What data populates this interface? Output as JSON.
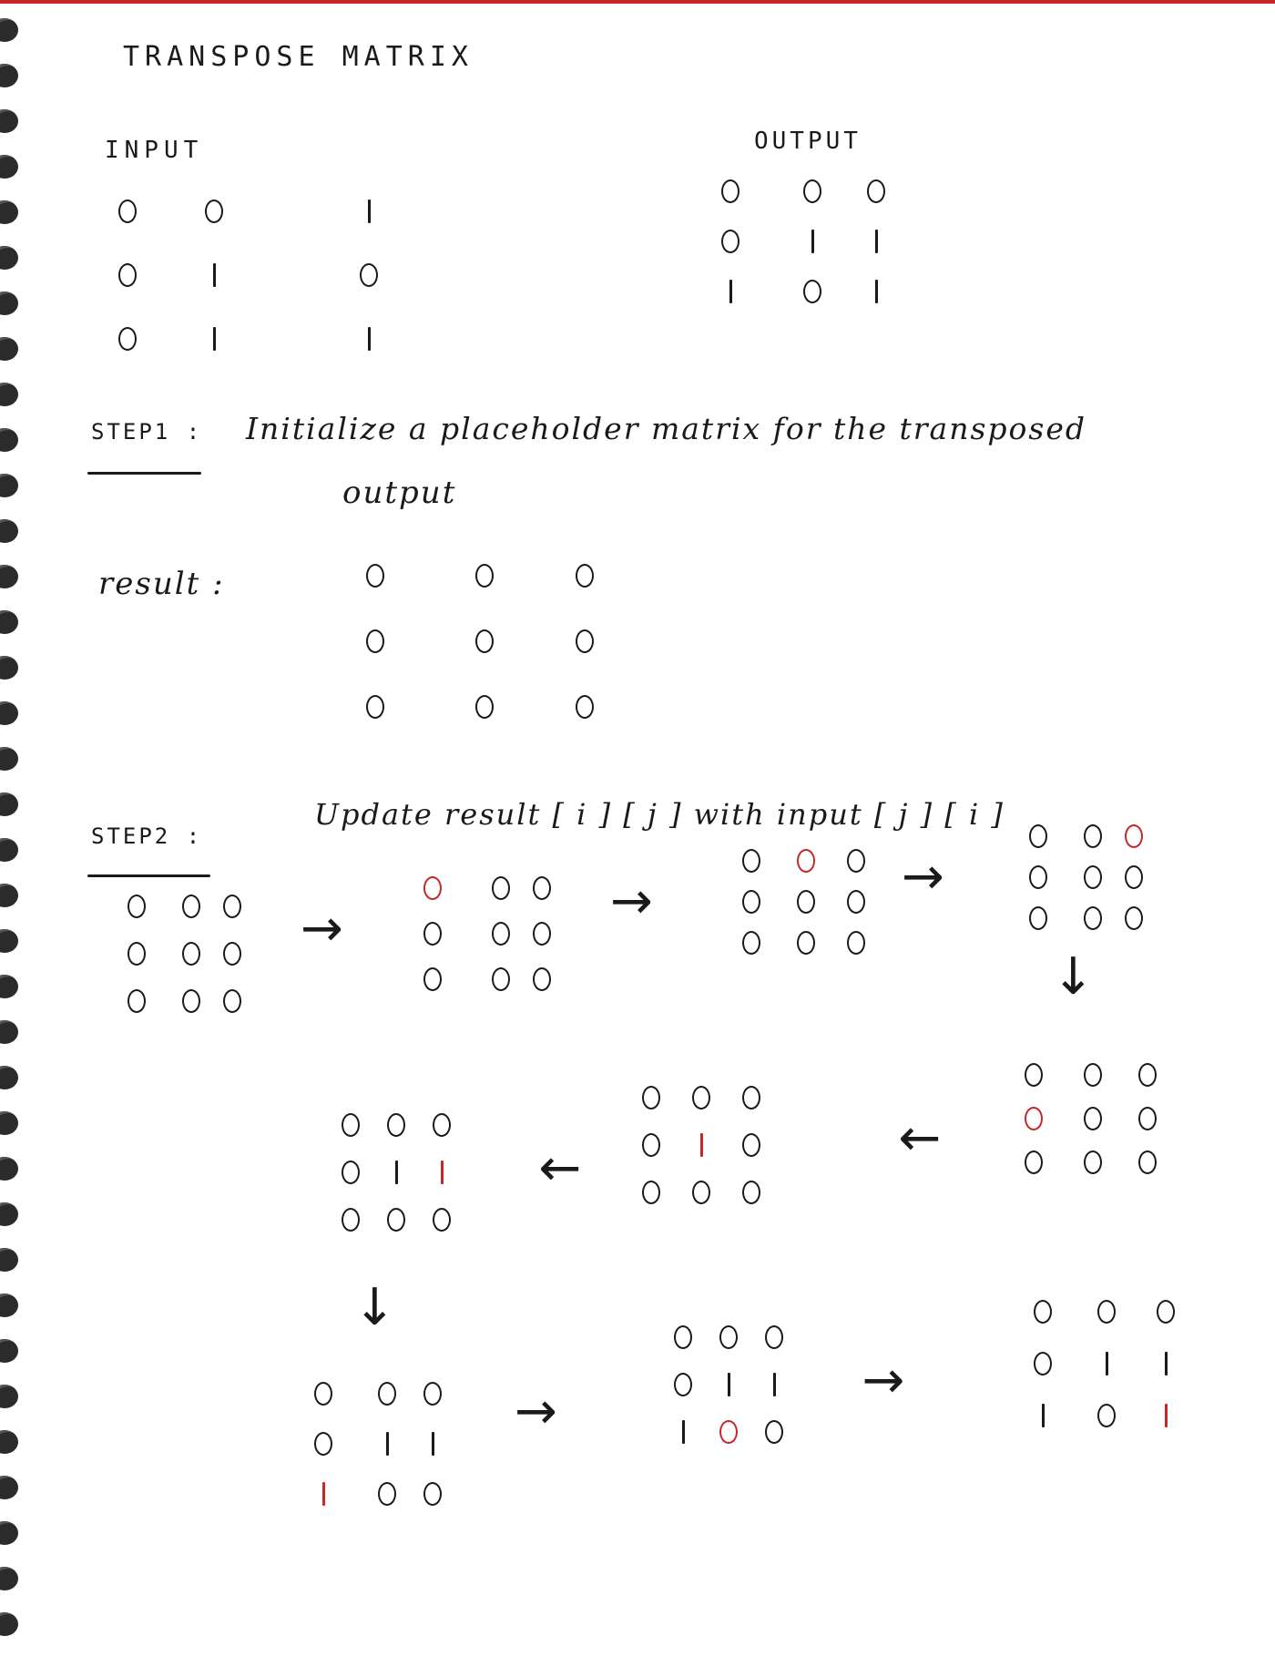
{
  "title": "TRANSPOSE MATRIX",
  "labels": {
    "input": "INPUT",
    "output": "OUTPUT",
    "step1_label": "STEP1 :",
    "step1_text_line1": "Initialize a placeholder matrix for the transposed",
    "step1_text_line2": "output",
    "result_label": "result :",
    "step2_label": "STEP2 :",
    "step2_text": "Update result [ i ] [ j ] with input [ j ] [ i ]"
  },
  "colors": {
    "ink": "#1a1a1a",
    "highlight": "#c62828"
  },
  "arrow_glyphs": {
    "right": "→",
    "down": "↓",
    "left": "←"
  },
  "matrices": {
    "input": [
      [
        "0",
        "0",
        "1"
      ],
      [
        "0",
        "1",
        "0"
      ],
      [
        "0",
        "1",
        "1"
      ]
    ],
    "output": [
      [
        "0",
        "0",
        "0"
      ],
      [
        "0",
        "1",
        "1"
      ],
      [
        "1",
        "0",
        "1"
      ]
    ],
    "result": [
      [
        "0",
        "0",
        "0"
      ],
      [
        "0",
        "0",
        "0"
      ],
      [
        "0",
        "0",
        "0"
      ]
    ],
    "steps": [
      {
        "values": [
          [
            "0",
            "0",
            "0"
          ],
          [
            "0",
            "0",
            "0"
          ],
          [
            "0",
            "0",
            "0"
          ]
        ],
        "highlight": []
      },
      {
        "values": [
          [
            "0",
            "0",
            "0"
          ],
          [
            "0",
            "0",
            "0"
          ],
          [
            "0",
            "0",
            "0"
          ]
        ],
        "highlight": [
          [
            0,
            0
          ]
        ]
      },
      {
        "values": [
          [
            "0",
            "0",
            "0"
          ],
          [
            "0",
            "0",
            "0"
          ],
          [
            "0",
            "0",
            "0"
          ]
        ],
        "highlight": [
          [
            0,
            1
          ]
        ]
      },
      {
        "values": [
          [
            "0",
            "0",
            "0"
          ],
          [
            "0",
            "0",
            "0"
          ],
          [
            "0",
            "0",
            "0"
          ]
        ],
        "highlight": [
          [
            0,
            2
          ]
        ]
      },
      {
        "values": [
          [
            "0",
            "0",
            "0"
          ],
          [
            "0",
            "0",
            "0"
          ],
          [
            "0",
            "0",
            "0"
          ]
        ],
        "highlight": [
          [
            1,
            0
          ]
        ]
      },
      {
        "values": [
          [
            "0",
            "0",
            "0"
          ],
          [
            "0",
            "1",
            "0"
          ],
          [
            "0",
            "0",
            "0"
          ]
        ],
        "highlight": [
          [
            1,
            1
          ]
        ]
      },
      {
        "values": [
          [
            "0",
            "0",
            "0"
          ],
          [
            "0",
            "1",
            "1"
          ],
          [
            "0",
            "0",
            "0"
          ]
        ],
        "highlight": [
          [
            1,
            2
          ]
        ]
      },
      {
        "values": [
          [
            "0",
            "0",
            "0"
          ],
          [
            "0",
            "1",
            "1"
          ],
          [
            "1",
            "0",
            "0"
          ]
        ],
        "highlight": [
          [
            2,
            0
          ]
        ]
      },
      {
        "values": [
          [
            "0",
            "0",
            "0"
          ],
          [
            "0",
            "1",
            "1"
          ],
          [
            "1",
            "0",
            "0"
          ]
        ],
        "highlight": [
          [
            2,
            1
          ]
        ]
      },
      {
        "values": [
          [
            "0",
            "0",
            "0"
          ],
          [
            "0",
            "1",
            "1"
          ],
          [
            "1",
            "0",
            "1"
          ]
        ],
        "highlight": [
          [
            2,
            2
          ]
        ]
      }
    ]
  }
}
